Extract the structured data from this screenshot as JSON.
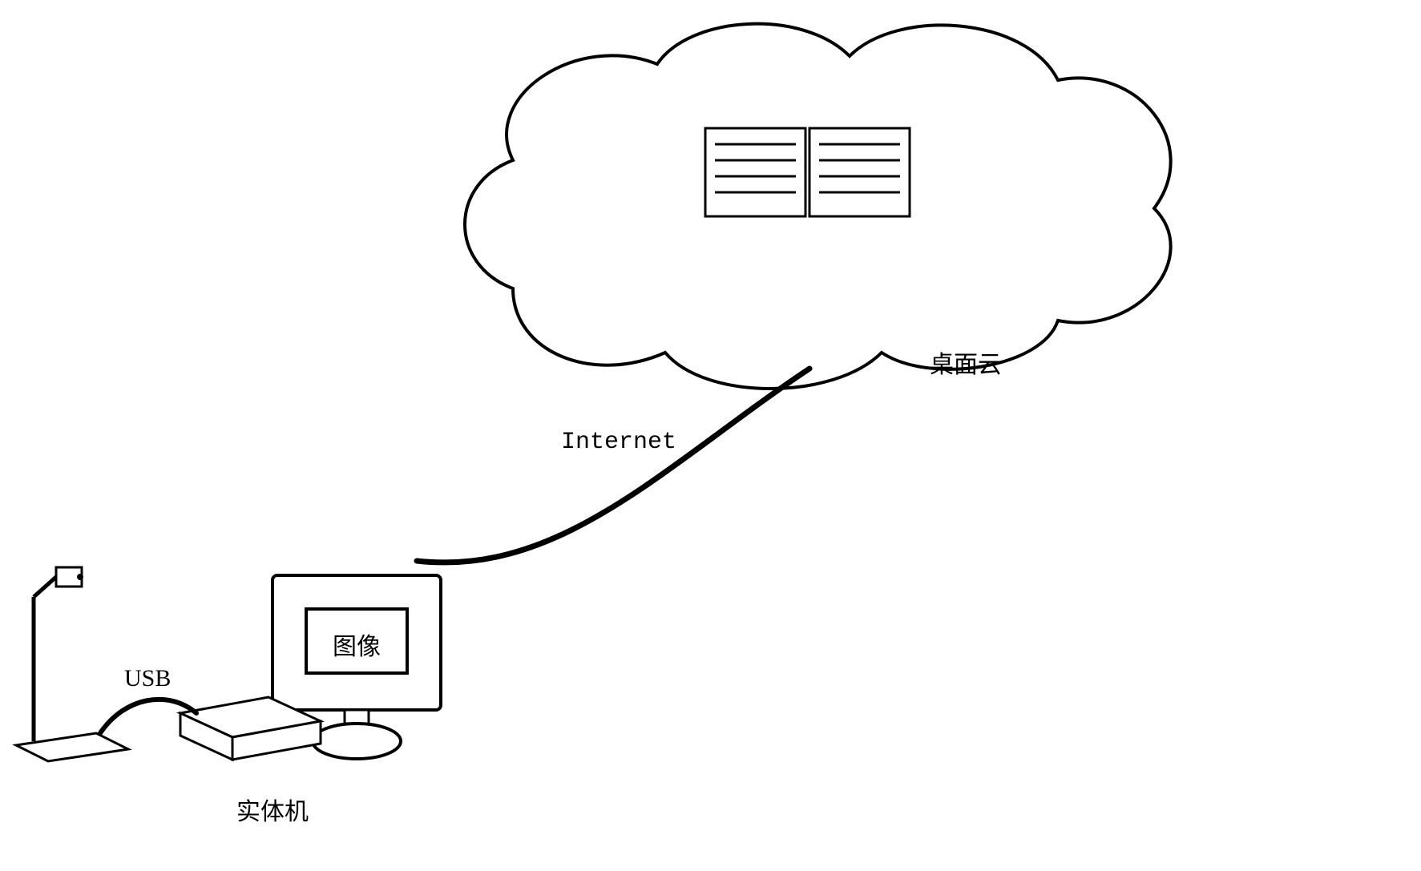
{
  "labels": {
    "cloud": "桌面云",
    "internet": "Internet",
    "usb": "USB",
    "physical_machine": "实体机",
    "image_box": "图像"
  },
  "diagram": {
    "nodes": {
      "camera_device": {
        "type": "document-scanner",
        "connected_via": "USB",
        "connected_to": "physical_machine"
      },
      "physical_machine": {
        "type": "thin-client-with-monitor",
        "screen_content_key": "labels.image_box"
      },
      "cloud_desktop": {
        "type": "cloud",
        "contains": "open-book-icon"
      }
    },
    "edges": [
      {
        "from": "camera_device",
        "to": "physical_machine",
        "label_key": "labels.usb"
      },
      {
        "from": "physical_machine",
        "to": "cloud_desktop",
        "label_key": "labels.internet"
      }
    ]
  },
  "chart_data": {
    "type": "diagram",
    "title": "",
    "description": "A physical machine (thin client + monitor showing 图像) is connected via USB to a document-camera-style scanner, and over the Internet to a 桌面云 (desktop cloud) containing a book/pages icon.",
    "nodes": [
      {
        "id": "scanner",
        "label": "document scanner/camera"
      },
      {
        "id": "physical_machine",
        "label": "实体机",
        "screen": "图像"
      },
      {
        "id": "desktop_cloud",
        "label": "桌面云",
        "content": "open book (pages with lines)"
      }
    ],
    "edges": [
      {
        "from": "scanner",
        "to": "physical_machine",
        "label": "USB"
      },
      {
        "from": "physical_machine",
        "to": "desktop_cloud",
        "label": "Internet"
      }
    ]
  }
}
